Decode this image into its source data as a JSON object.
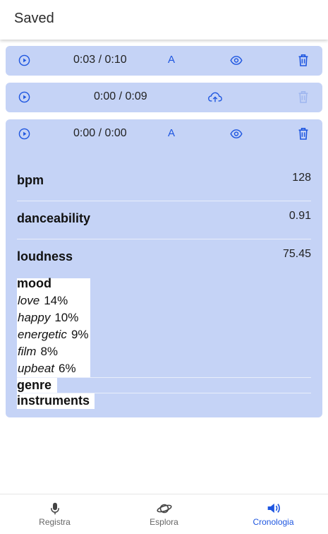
{
  "header": {
    "title": "Saved"
  },
  "recordings": [
    {
      "time": "0:03 / 0:10",
      "badge": "A",
      "has_upload": false
    },
    {
      "time": "0:00 / 0:09",
      "badge": "",
      "has_upload": true
    },
    {
      "time": "0:00 / 0:00",
      "badge": "A",
      "has_upload": false
    }
  ],
  "analysis": {
    "metrics": [
      {
        "label": "bpm",
        "value": "128"
      },
      {
        "label": "danceability",
        "value": "0.91"
      },
      {
        "label": "loudness",
        "value": "75.45"
      }
    ],
    "mood": {
      "title": "mood",
      "items": [
        {
          "label": "love",
          "pct": "14%"
        },
        {
          "label": "happy",
          "pct": "10%"
        },
        {
          "label": "energetic",
          "pct": "9%"
        },
        {
          "label": "film",
          "pct": "8%"
        },
        {
          "label": "upbeat",
          "pct": "6%"
        }
      ]
    },
    "genre_label": "genre",
    "instruments_label": "instruments"
  },
  "nav": {
    "items": [
      {
        "label": "Registra",
        "icon": "microphone-icon"
      },
      {
        "label": "Esplora",
        "icon": "planet-icon"
      },
      {
        "label": "Cronologia",
        "icon": "speaker-icon",
        "active": true
      }
    ]
  },
  "colors": {
    "accent": "#1e56e0",
    "card": "#c5d3f6",
    "disabled": "#9fb6ef"
  }
}
